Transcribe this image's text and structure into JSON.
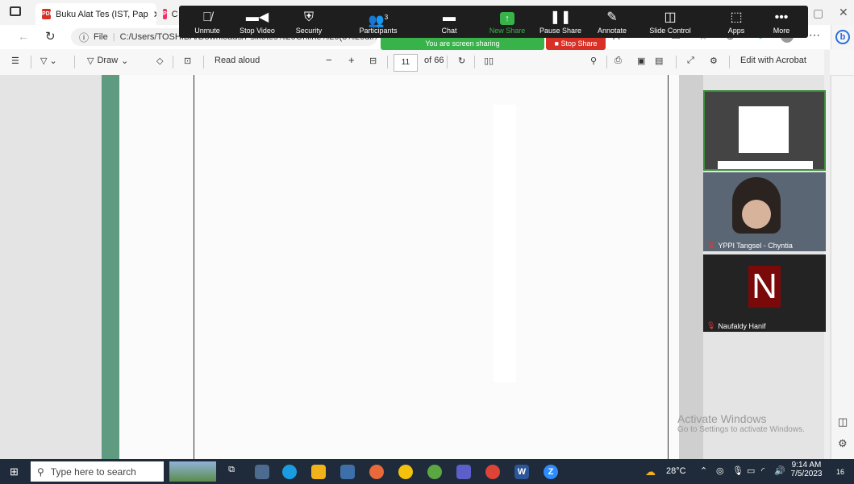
{
  "browser": {
    "tabs": [
      {
        "label": "Buku Alat Tes (IST, Pap"
      },
      {
        "label": "C"
      }
    ],
    "address": {
      "file_label": "File",
      "url": "C:/Users/TOSHIBA/Downloads/Psikotes%20Online%20(3%20dll%"
    }
  },
  "zoom": {
    "buttons": {
      "unmute": "Unmute",
      "stop_video": "Stop Video",
      "security": "Security",
      "participants": "Participants",
      "participants_count": "3",
      "chat": "Chat",
      "new_share": "New Share",
      "pause_share": "Pause Share",
      "annotate": "Annotate",
      "slide_control": "Slide Control",
      "apps": "Apps",
      "more": "More"
    },
    "share_banner": "You are screen sharing",
    "stop_share": "Stop Share",
    "participants": [
      {
        "name": ""
      },
      {
        "name": "YPPI Tangsel - Chyntia"
      },
      {
        "name": "Naufaldy Hanif",
        "initial": "N"
      }
    ]
  },
  "pdf_toolbar": {
    "draw": "Draw",
    "read_aloud": "Read aloud",
    "page_current": "11",
    "page_total": "of 66",
    "edit_acrobat": "Edit with Acrobat"
  },
  "watermark": {
    "title": "Activate Windows",
    "subtitle": "Go to Settings to activate Windows."
  },
  "taskbar": {
    "search_placeholder": "Type here to search",
    "weather": "28°C",
    "time": "9:14 AM",
    "date": "7/5/2023",
    "notifications": "16"
  },
  "colors": {
    "zoom_bar": "#1e1e1e",
    "share_green": "#38b34a",
    "stop_red": "#d93025",
    "taskbar": "#1f2b3a"
  }
}
